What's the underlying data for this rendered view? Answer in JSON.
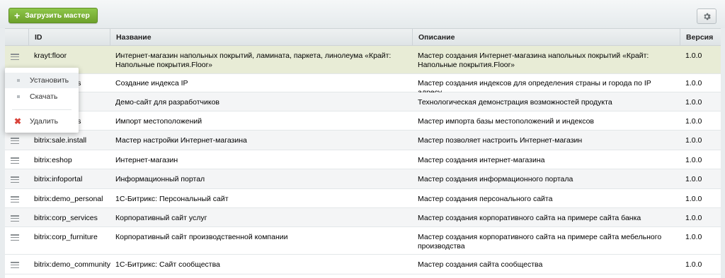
{
  "toolbar": {
    "upload_label": "Загрузить мастер",
    "upload_icon": "plus-icon",
    "settings_icon": "gear-icon",
    "accent_color": "#7db53b"
  },
  "table": {
    "columns": [
      "ID",
      "Название",
      "Описание",
      "Версия"
    ],
    "rows": [
      {
        "id": "krayt:floor",
        "name": "Интернет-магазин напольных покрытий, ламината, паркета, линолеума «Крайт: Напольные покрытия.Floor»",
        "description": "Мастер создания Интернет-магазина напольных покрытий «Крайт: Напольные покрытия.Floor»",
        "version": "1.0.0"
      },
      {
        "id": "bitrix:locations",
        "name": "Создание индекса IP",
        "description": "Мастер создания индексов для определения страны и города по IP адресу",
        "version": "1.0.0"
      },
      {
        "id": "",
        "name": "Демо-сайт для разработчиков",
        "description": "Технологическая демонстрация возможностей продукта",
        "version": "1.0.0"
      },
      {
        "id": "bitrix:locations",
        "name": "Импорт местоположений",
        "description": "Мастер импорта базы местоположений и индексов",
        "version": "1.0.0"
      },
      {
        "id": "bitrix:sale.install",
        "name": "Мастер настройки Интернет-магазина",
        "description": "Мастер позволяет настроить Интернет-магазин",
        "version": "1.0.0"
      },
      {
        "id": "bitrix:eshop",
        "name": "Интернет-магазин",
        "description": "Мастер создания интернет-магазина",
        "version": "1.0.0"
      },
      {
        "id": "bitrix:infoportal",
        "name": "Информационный портал",
        "description": "Мастер создания информационного портала",
        "version": "1.0.0"
      },
      {
        "id": "bitrix:demo_personal",
        "name": "1С-Битрикс: Персональный сайт",
        "description": "Мастер создания персонального сайта",
        "version": "1.0.0"
      },
      {
        "id": "bitrix:corp_services",
        "name": "Корпоративный сайт услуг",
        "description": "Мастер создания корпоративного сайта на примере сайта банка",
        "version": "1.0.0"
      },
      {
        "id": "bitrix:corp_furniture",
        "name": "Корпоративный сайт производственной компании",
        "description": "Мастер создания корпоративного сайта на примере сайта мебельного производства",
        "version": "1.0.0"
      },
      {
        "id": "bitrix:demo_community",
        "name": "1С-Битрикс: Сайт сообщества",
        "description": "Мастер создания сайта сообщества",
        "version": "1.0.0"
      }
    ]
  },
  "context_menu": {
    "install": "Установить",
    "download": "Скачать",
    "delete": "Удалить",
    "delete_icon": "delete-x-icon"
  }
}
